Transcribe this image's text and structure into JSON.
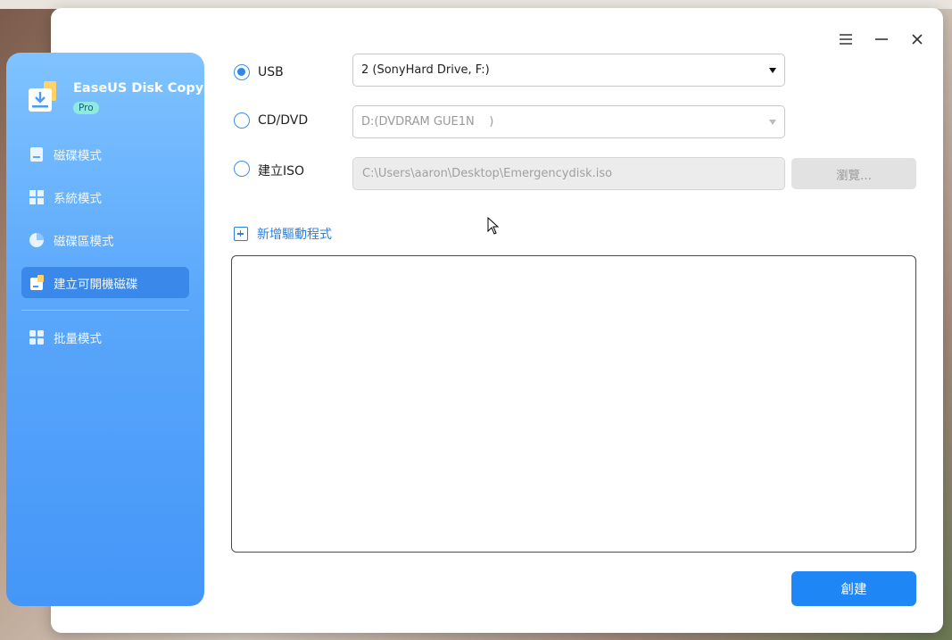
{
  "window": {
    "controls": {
      "menu_icon": "menu-icon",
      "minimize_icon": "minimize-icon",
      "close_icon": "close-icon"
    }
  },
  "sidebar": {
    "app_name": "EaseUS Disk Copy",
    "edition_badge": "Pro",
    "items": [
      {
        "label": "磁碟模式",
        "icon": "disk-icon",
        "active": false
      },
      {
        "label": "系統模式",
        "icon": "windows-icon",
        "active": false
      },
      {
        "label": "磁碟區模式",
        "icon": "pie-chart-icon",
        "active": false
      },
      {
        "label": "建立可開機磁碟",
        "icon": "bootable-disk-icon",
        "active": true
      },
      {
        "label": "批量模式",
        "icon": "grid-icon",
        "active": false
      }
    ]
  },
  "main": {
    "options": [
      {
        "label": "USB",
        "selected": true,
        "value": "2 (SonyHard Drive, F:)"
      },
      {
        "label": "CD/DVD",
        "selected": false,
        "value": "D:(DVDRAM GUE1N    )"
      },
      {
        "label": "建立ISO",
        "selected": false,
        "value": "C:\\Users\\aaron\\Desktop\\Emergencydisk.iso"
      }
    ],
    "browse_label": "瀏覽...",
    "add_driver_label": "新增驅動程式",
    "create_label": "創建"
  },
  "colors": {
    "accent": "#1e86f5",
    "sidebar_top": "#7fc3ff",
    "sidebar_bottom": "#4496f8",
    "link": "#2b7fe0"
  }
}
